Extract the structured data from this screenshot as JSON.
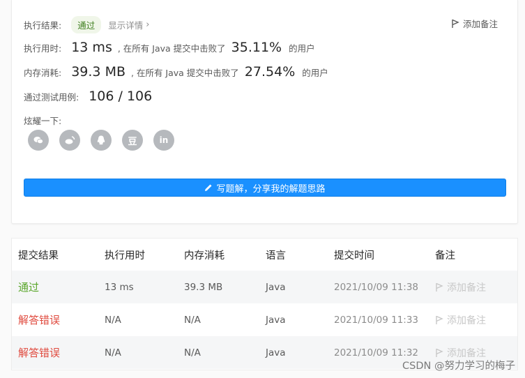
{
  "result": {
    "label": "执行结果:",
    "status": "通过",
    "detail": "显示详情",
    "note": "添加备注"
  },
  "runtime": {
    "label": "执行用时:",
    "value": "13 ms",
    "mid": ", 在所有 Java 提交中击败了",
    "percent": "35.11%",
    "suffix": "的用户"
  },
  "memory": {
    "label": "内存消耗:",
    "value": "39.3 MB",
    "mid": ", 在所有 Java 提交中击败了",
    "percent": "27.54%",
    "suffix": "的用户"
  },
  "tests": {
    "label": "通过测试用例:",
    "value": "106 / 106"
  },
  "share": {
    "label": "炫耀一下:",
    "items": [
      "wechat-icon",
      "weibo-icon",
      "qq-icon",
      "douban-icon",
      "linkedin-icon"
    ],
    "douban_glyph": "豆",
    "linkedin_glyph": "in"
  },
  "write_button": "写题解，分享我的解题思路",
  "table": {
    "headers": [
      "提交结果",
      "执行用时",
      "内存消耗",
      "语言",
      "提交时间",
      "备注"
    ],
    "rows": [
      {
        "result": "通过",
        "time": "13 ms",
        "memory": "39.3 MB",
        "lang": "Java",
        "submitted": "2021/10/09 11:38",
        "note": "添加备注"
      },
      {
        "result": "解答错误",
        "time": "N/A",
        "memory": "N/A",
        "lang": "Java",
        "submitted": "2021/10/09 11:33",
        "note": "添加备注"
      },
      {
        "result": "解答错误",
        "time": "N/A",
        "memory": "N/A",
        "lang": "Java",
        "submitted": "2021/10/09 11:32",
        "note": "添加备注"
      }
    ]
  },
  "watermark": "CSDN @努力学习的梅子",
  "colors": {
    "accent": "#1a90ff",
    "success": "#5aa62b",
    "error": "#e04b3f"
  }
}
